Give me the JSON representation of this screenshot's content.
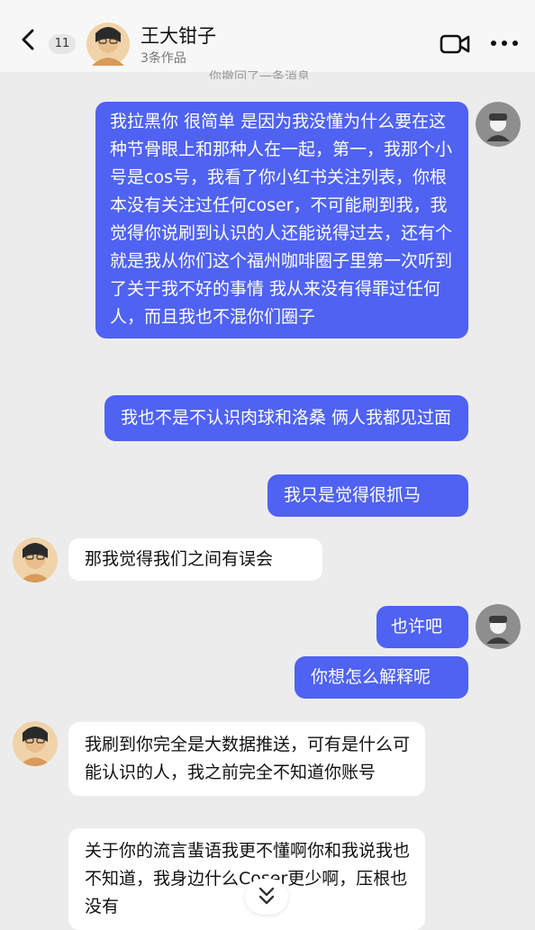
{
  "header": {
    "unread_count": "11",
    "contact_name": "王大钳子",
    "works": "3条作品"
  },
  "truncated_notice": "你撤回了一条消息",
  "messages": [
    {
      "from": "me",
      "text": "我拉黑你 很简单 是因为我没懂为什么要在这种节骨眼上和那种人在一起，第一，我那个小号是cos号，我看了你小红书关注列表，你根本没有关注过任何coser，不可能刷到我，我觉得你说刷到认识的人还能说得过去，还有个就是我从你们这个福州咖啡圈子里第一次听到了关于我不好的事情 我从来没有得罪过任何人，而且我也不混你们圈子"
    },
    {
      "from": "me",
      "text": "我也不是不认识肉球和洛桑 俩人我都见过面"
    },
    {
      "from": "me",
      "text": "我只是觉得很抓马"
    },
    {
      "from": "them",
      "text": "那我觉得我们之间有误会"
    },
    {
      "from": "me",
      "text": "也许吧"
    },
    {
      "from": "me",
      "text": "你想怎么解释呢"
    },
    {
      "from": "them",
      "text": "我刷到你完全是大数据推送，可有是什么可能认识的人，我之前完全不知道你账号"
    },
    {
      "from": "them",
      "text": "关于你的流言蜚语我更不懂啊你和我说我也不知道，我身边什么Coser更少啊，压根也没有"
    }
  ],
  "icons": {
    "back": "chevron-left-icon",
    "video": "video-camera-icon",
    "more": "more-dots-icon",
    "scroll": "double-chevron-down-icon"
  },
  "colors": {
    "my_bubble": "#4f62f2",
    "their_bubble": "#ffffff",
    "background": "#ececec"
  }
}
